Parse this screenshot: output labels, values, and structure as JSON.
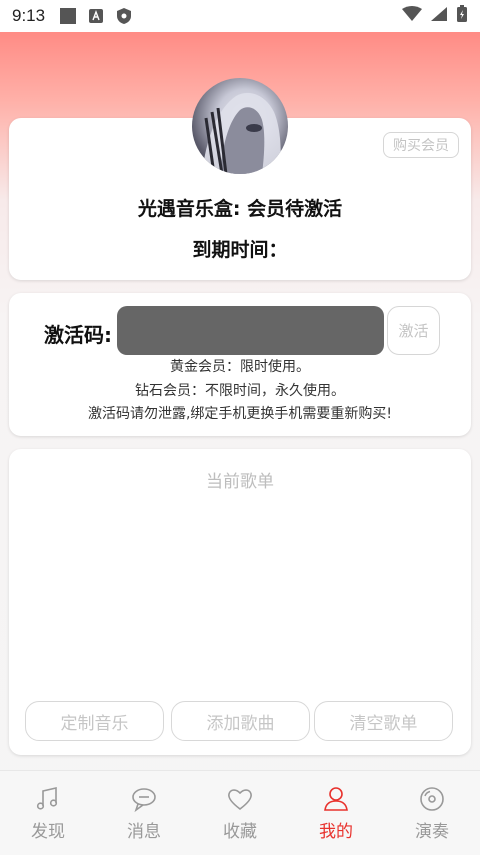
{
  "status_bar": {
    "time": "9:13"
  },
  "profile": {
    "buy_label": "购买会员",
    "member_title": "光遇音乐盒: 会员待激活",
    "expire_label": "到期时间："
  },
  "activation": {
    "label": "激活码:",
    "input_value": "",
    "input_placeholder": "",
    "button_label": "激活",
    "notes": [
      "黄金会员：限时使用。",
      "钻石会员：不限时间，永久使用。",
      "激活码请勿泄露,绑定手机更换手机需要重新购买!"
    ]
  },
  "playlist": {
    "title": "当前歌单",
    "buttons": [
      "定制音乐",
      "添加歌曲",
      "清空歌单"
    ]
  },
  "nav": {
    "items": [
      {
        "label": "发现",
        "icon": "music-note-icon"
      },
      {
        "label": "消息",
        "icon": "chat-bubble-icon"
      },
      {
        "label": "收藏",
        "icon": "heart-icon"
      },
      {
        "label": "我的",
        "icon": "user-icon"
      },
      {
        "label": "演奏",
        "icon": "disc-icon"
      }
    ],
    "active_index": 3,
    "active_color": "#e8322d"
  }
}
